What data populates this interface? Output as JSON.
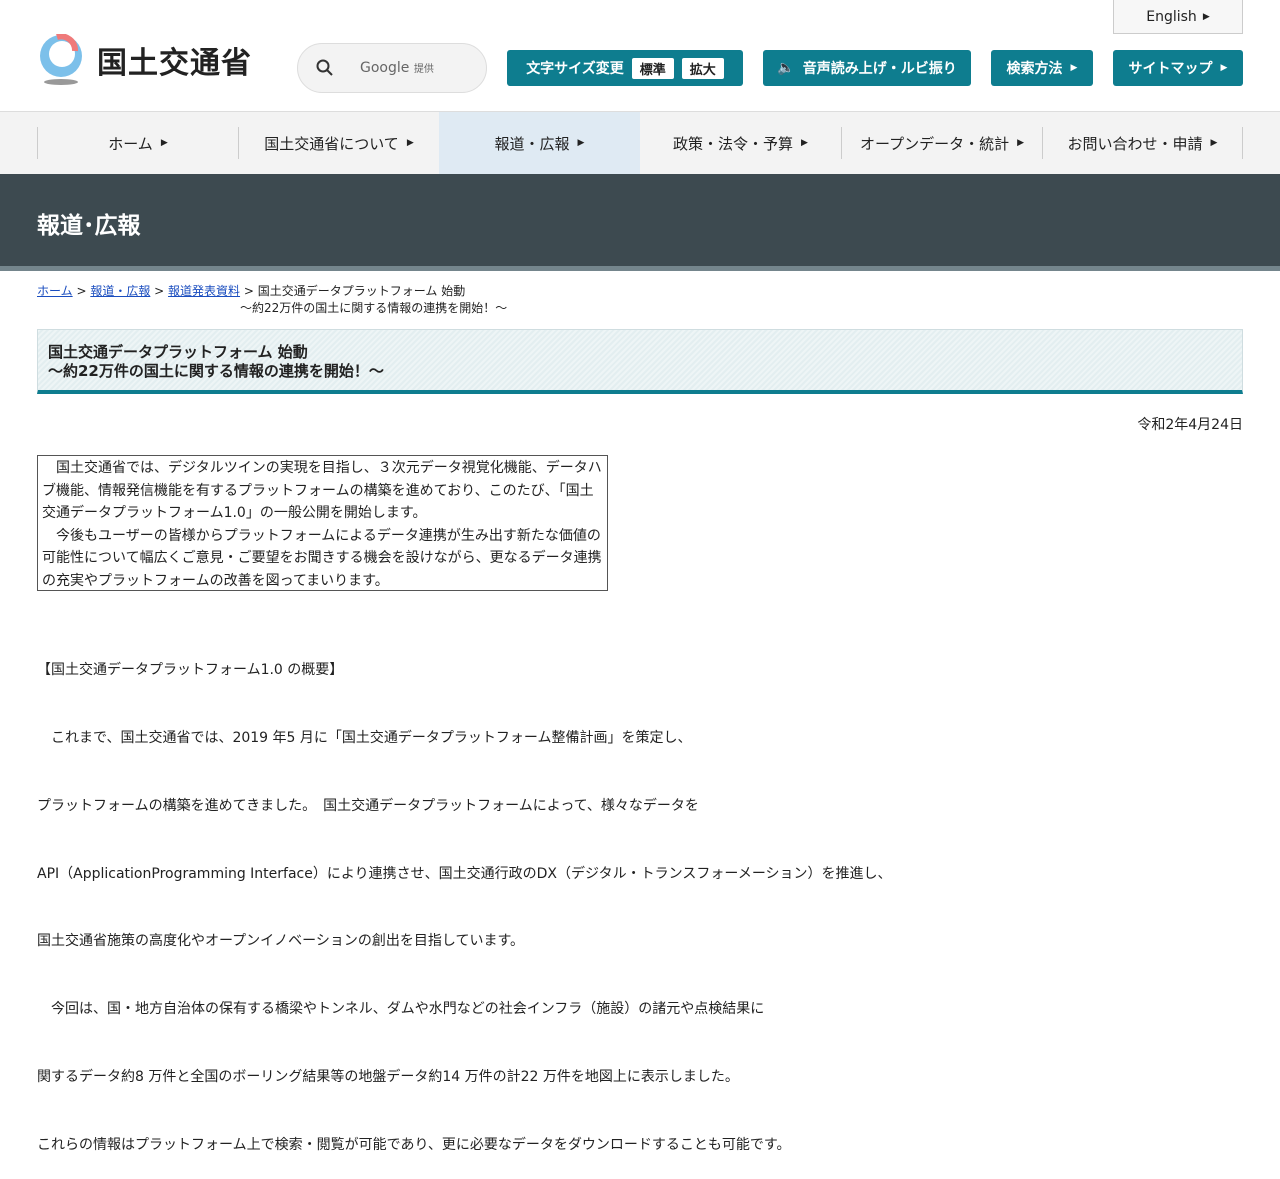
{
  "header": {
    "english": "English",
    "logo": "国土交通省",
    "search_brand": "Google",
    "search_provided": "提供",
    "font_size_label": "文字サイズ変更",
    "font_standard": "標準",
    "font_large": "拡大",
    "speech": "音声読み上げ・ルビ振り",
    "search_method": "検索方法",
    "sitemap": "サイトマップ"
  },
  "nav": [
    "ホーム",
    "国土交通省について",
    "報道・広報",
    "政策・法令・予算",
    "オープンデータ・統計",
    "お問い合わせ・申請"
  ],
  "band_title": "報道･広報",
  "breadcrumb": {
    "home": "ホーム",
    "press": "報道・広報",
    "releases": "報道発表資料",
    "current1": "国土交通データプラットフォーム 始動",
    "current2": "～約22万件の国土に関する情報の連携を開始！～"
  },
  "title": {
    "line1": "国土交通データプラットフォーム 始動",
    "line2": "～約22万件の国土に関する情報の連携を開始！～"
  },
  "date": "令和2年4月24日",
  "summary": [
    "　国土交通省では、デジタルツインの実現を目指し、３次元データ視覚化機能、データハブ機能、情報発信機能を有するプラットフォームの構築を進めており、このたび、「国土交通データプラットフォーム1.0」の一般公開を開始します。",
    "　今後もユーザーの皆様からプラットフォームによるデータ連携が生み出す新たな価値の可能性について幅広くご意見・ご要望をお聞きする機会を設けながら、更なるデータ連携の充実やプラットフォームの改善を図ってまいります。"
  ],
  "body": [
    "【国土交通データプラットフォーム1.0 の概要】",
    "　これまで、国土交通省では、2019 年5 月に「国土交通データプラットフォーム整備計画」を策定し、",
    "プラットフォームの構築を進めてきました。　国土交通データプラットフォームによって、様々なデータを",
    "API（ApplicationProgramming Interface）により連携させ、国土交通行政のDX（デジタル・トランスフォーメーション）を推進し、",
    "国土交通省施策の高度化やオープンイノベーションの創出を目指しています。",
    "　今回は、国・地方自治体の保有する橋梁やトンネル、ダムや水門などの社会インフラ（施設）の諸元や点検結果に",
    "関するデータ約8 万件と全国のボーリング結果等の地盤データ約14 万件の計22 万件を地図上に表示しました。",
    "これらの情報はプラットフォーム上で検索・閲覧が可能であり、更に必要なデータをダウンロードすることも可能です。"
  ]
}
